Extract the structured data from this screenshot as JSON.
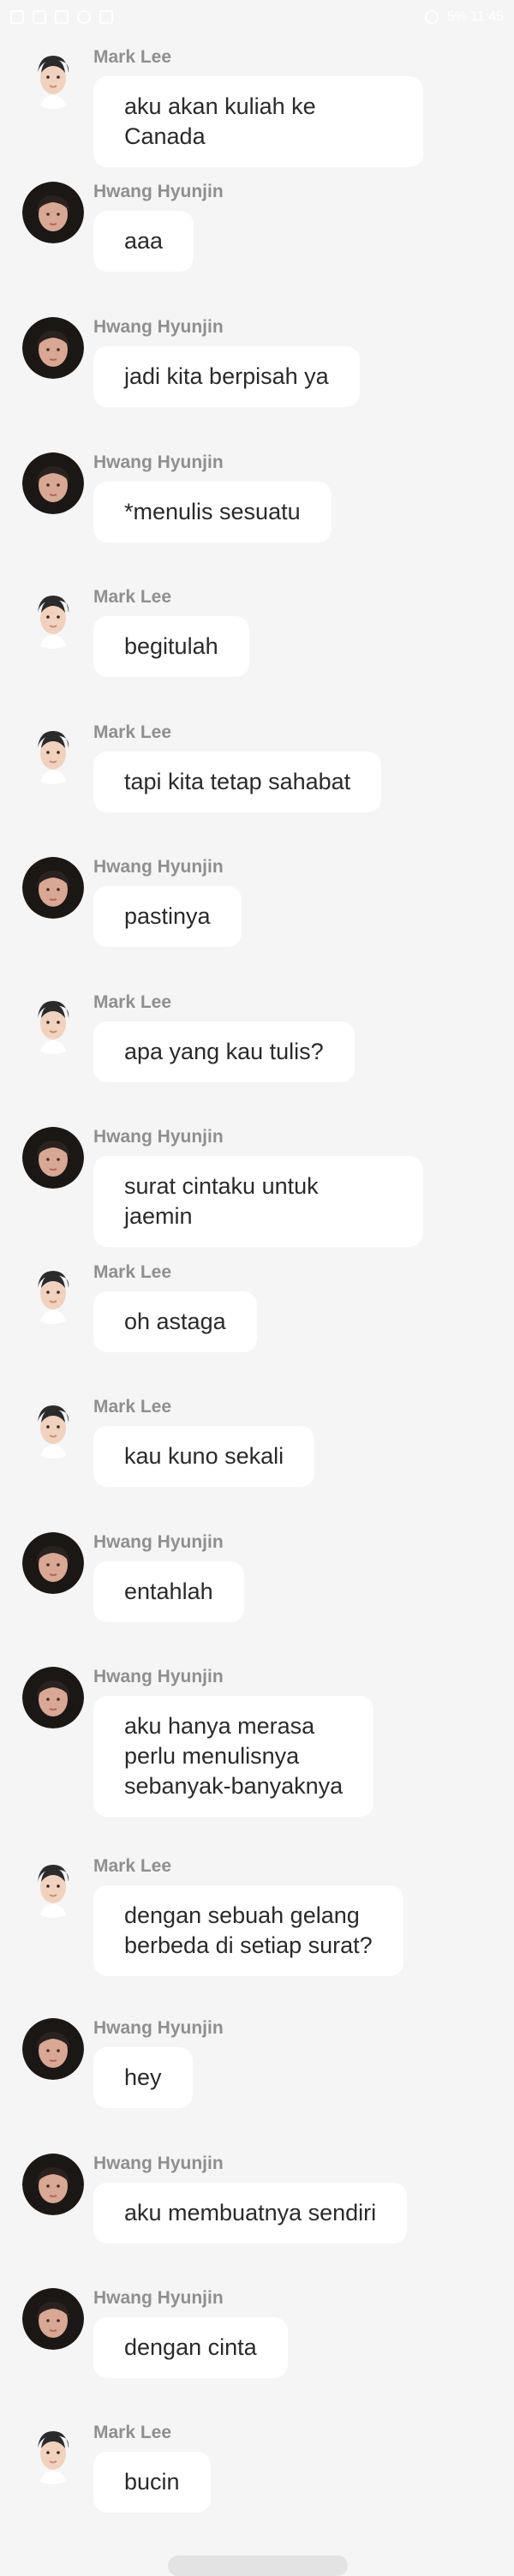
{
  "status_bar": {
    "left_icons": [
      "home-icon",
      "app-icon",
      "gallery-icon",
      "message-icon",
      "mail-icon"
    ],
    "right_text": "5% 11:45"
  },
  "messages": [
    {
      "sender": "Mark Lee",
      "avatar": "mark-lee-avatar",
      "text": "aku akan kuliah ke Canada"
    },
    {
      "sender": "Hwang Hyunjin",
      "avatar": "hwang-hyunjin-avatar",
      "text": "aaa"
    },
    {
      "sender": "Hwang Hyunjin",
      "avatar": "hwang-hyunjin-avatar",
      "text": "jadi kita berpisah ya"
    },
    {
      "sender": "Hwang Hyunjin",
      "avatar": "hwang-hyunjin-avatar",
      "text": "*menulis sesuatu"
    },
    {
      "sender": "Mark Lee",
      "avatar": "mark-lee-avatar",
      "text": "begitulah"
    },
    {
      "sender": "Mark Lee",
      "avatar": "mark-lee-avatar",
      "text": "tapi kita tetap sahabat"
    },
    {
      "sender": "Hwang Hyunjin",
      "avatar": "hwang-hyunjin-avatar",
      "text": "pastinya"
    },
    {
      "sender": "Mark Lee",
      "avatar": "mark-lee-avatar",
      "text": "apa yang kau tulis?"
    },
    {
      "sender": "Hwang Hyunjin",
      "avatar": "hwang-hyunjin-avatar",
      "text": "surat cintaku untuk jaemin"
    },
    {
      "sender": "Mark Lee",
      "avatar": "mark-lee-avatar",
      "text": "oh astaga"
    },
    {
      "sender": "Mark Lee",
      "avatar": "mark-lee-avatar",
      "text": "kau kuno sekali"
    },
    {
      "sender": "Hwang Hyunjin",
      "avatar": "hwang-hyunjin-avatar",
      "text": "entahlah"
    },
    {
      "sender": "Hwang Hyunjin",
      "avatar": "hwang-hyunjin-avatar",
      "text": "aku hanya merasa\nperlu menulisnya\nsebanyak-banyaknya"
    },
    {
      "sender": "Mark Lee",
      "avatar": "mark-lee-avatar",
      "text": "dengan sebuah gelang\nberbeda di setiap surat?"
    },
    {
      "sender": "Hwang Hyunjin",
      "avatar": "hwang-hyunjin-avatar",
      "text": "hey"
    },
    {
      "sender": "Hwang Hyunjin",
      "avatar": "hwang-hyunjin-avatar",
      "text": "aku membuatnya sendiri"
    },
    {
      "sender": "Hwang Hyunjin",
      "avatar": "hwang-hyunjin-avatar",
      "text": "dengan cinta"
    },
    {
      "sender": "Mark Lee",
      "avatar": "mark-lee-avatar",
      "text": "bucin"
    }
  ]
}
